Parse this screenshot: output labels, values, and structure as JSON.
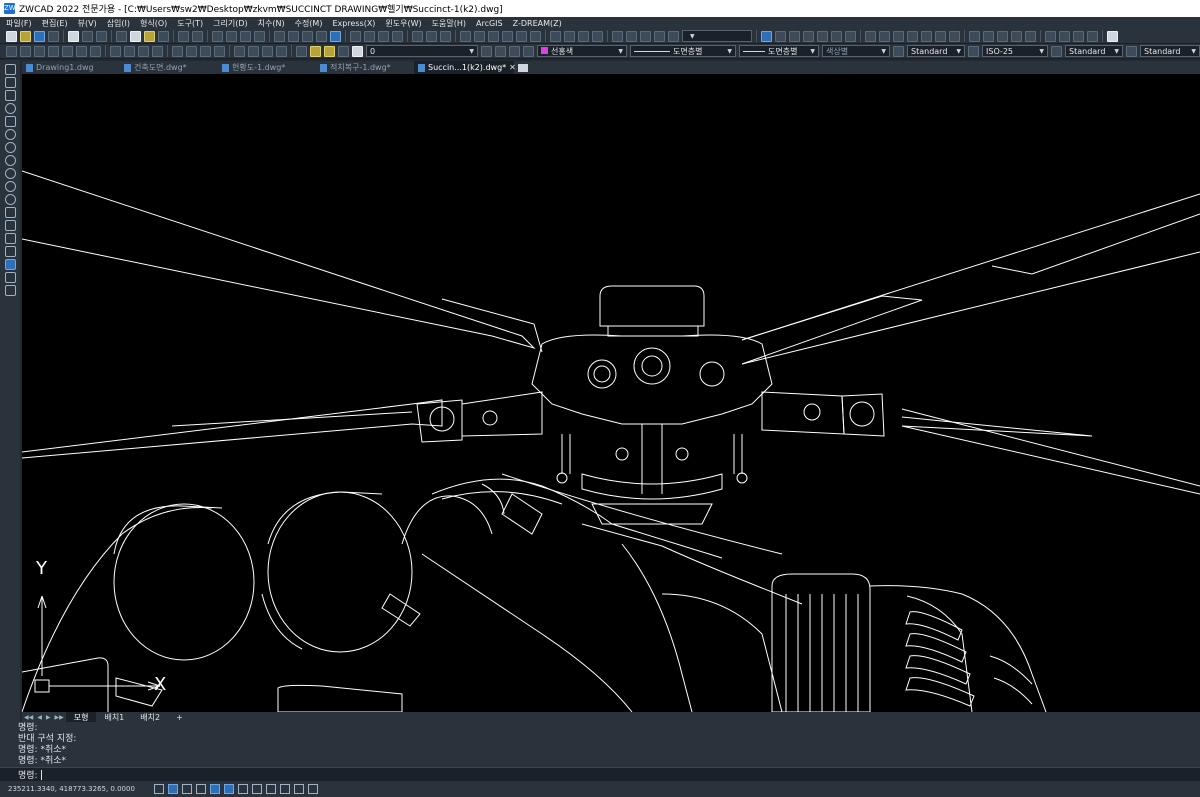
{
  "window": {
    "title": "ZWCAD 2022 전문가용 - [C:₩Users₩sw2₩Desktop₩zkvm₩SUCCINCT DRAWING₩헬기₩Succinct-1(k2).dwg]",
    "logo": "ZW"
  },
  "menu": [
    "파일(F)",
    "편집(E)",
    "뷰(V)",
    "삽입(I)",
    "형식(O)",
    "도구(T)",
    "그리기(D)",
    "치수(N)",
    "수정(M)",
    "Express(X)",
    "윈도우(W)",
    "도움말(H)",
    "ArcGIS",
    "Z-DREAM(Z)"
  ],
  "toolbar": {
    "layer_combo": "0",
    "color_combo": "선홍색",
    "linetype_combo": "도면층별",
    "lineweight_combo": "도면층별",
    "plotstyle_combo": "색상별",
    "text_style": "Standard",
    "dim_style": "ISO-25",
    "table_style": "Standard",
    "multileader_style": "Standard"
  },
  "tabs": [
    {
      "label": "Drawing1.dwg",
      "active": false
    },
    {
      "label": "건축도면.dwg*",
      "active": false
    },
    {
      "label": "현황도-1.dwg*",
      "active": false
    },
    {
      "label": "적치복구-1.dwg*",
      "active": false
    },
    {
      "label": "Succin...1(k2).dwg*",
      "active": true
    }
  ],
  "ucs": {
    "y_label": "Y",
    "x_label": "X"
  },
  "layout_tabs": [
    {
      "label": "모형",
      "active": true
    },
    {
      "label": "배치1",
      "active": false
    },
    {
      "label": "배치2",
      "active": false
    },
    {
      "label": "+",
      "active": false
    }
  ],
  "command_history": [
    "명령:",
    "반대 구석 지정:",
    "명령: *취소*",
    "명령: *취소*"
  ],
  "command_prompt": "명령:",
  "status": {
    "coordinates": "235211.3340, 418773.3265, 0.0000"
  },
  "colors": {
    "canvas": "#000000",
    "chrome": "#2a323b",
    "drawing_lines": "#ffffff",
    "accent": "#2f6fb5"
  }
}
